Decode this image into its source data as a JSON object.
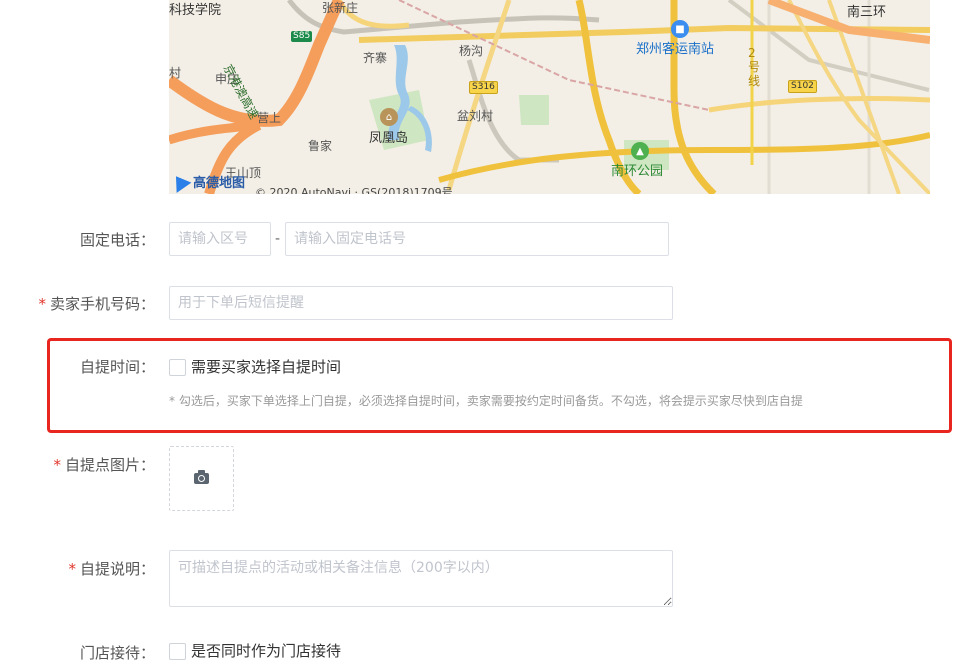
{
  "map": {
    "labels": {
      "school": "科技学院",
      "zhangxinzhuang": "张新庄",
      "nansanhuan": "南三环",
      "station": "郑州客运南站",
      "qizhai": "齐寨",
      "yanggou": "杨沟",
      "cun": "村",
      "shenzhuang": "申庄",
      "jinggang": "京港澳高速",
      "line2": "2号线",
      "yingshang": "营上",
      "penliucun": "盆刘村",
      "lujia": "鲁家",
      "fenghuangdao": "凤凰岛",
      "wangshanding": "王山顶",
      "nanhuan_park": "南环公园"
    },
    "shields": {
      "s85": "S85",
      "s316": "S316",
      "s102": "S102"
    },
    "logo": "高德地图",
    "copyright": "© 2020 AutoNavi · GS(2018)1709号",
    "icons": {
      "bus": "bus-station-icon",
      "museum": "landmark-icon",
      "park": "park-tree-icon",
      "logo": "amap-arrow-icon"
    }
  },
  "form": {
    "landline": {
      "label": "固定电话：",
      "area_placeholder": "请输入区号",
      "dash": "-",
      "number_placeholder": "请输入固定电话号"
    },
    "mobile": {
      "required_mark": "*",
      "label": "卖家手机号码：",
      "placeholder": "用于下单后短信提醒"
    },
    "pickup_time": {
      "label": "自提时间：",
      "checkbox_text": "需要买家选择自提时间",
      "hint": "* 勾选后，买家下单选择上门自提，必须选择自提时间，卖家需要按约定时间备货。不勾选，将会提示买家尽快到店自提"
    },
    "pickup_image": {
      "required_mark": "*",
      "label": "自提点图片：",
      "upload_icon": "camera-icon"
    },
    "pickup_desc": {
      "required_mark": "*",
      "label": "自提说明：",
      "placeholder": "可描述自提点的活动或相关备注信息（200字以内）"
    },
    "store_reception": {
      "label": "门店接待：",
      "checkbox_text": "是否同时作为门店接待"
    }
  },
  "colors": {
    "required": "#e0362b",
    "highlight_border": "#e8251e",
    "input_border": "#dcdfe6",
    "placeholder": "#c0c4cc"
  }
}
